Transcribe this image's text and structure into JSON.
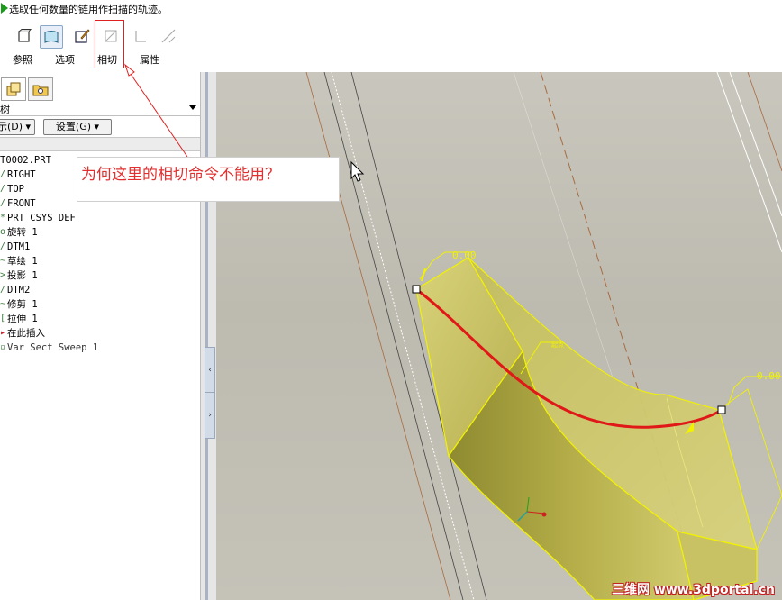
{
  "prompt": {
    "text": "选取任何数量的链用作扫描的轨迹。",
    "icon": "green-arrow-icon"
  },
  "dashboard": {
    "tools": [
      {
        "name": "solid-icon",
        "enabled": true,
        "active": false
      },
      {
        "name": "surface-icon",
        "enabled": true,
        "active": true
      },
      {
        "name": "sketch-edit-icon",
        "enabled": true,
        "active": false
      },
      {
        "name": "tangent-icon",
        "enabled": false,
        "active": false
      },
      {
        "name": "frame-icon",
        "enabled": false,
        "active": false
      },
      {
        "name": "normal-icon",
        "enabled": false,
        "active": false
      }
    ],
    "tabs": [
      "参照",
      "选项",
      "相切",
      "属性"
    ]
  },
  "tree": {
    "header_label": "树",
    "show_button": "示(D)",
    "settings_button": "设置(G)",
    "items": [
      {
        "label": "T0002.PRT",
        "icon": "part-icon"
      },
      {
        "label": "RIGHT",
        "icon": "datum-plane-icon"
      },
      {
        "label": "TOP",
        "icon": "datum-plane-icon"
      },
      {
        "label": "FRONT",
        "icon": "datum-plane-icon"
      },
      {
        "label": "PRT_CSYS_DEF",
        "icon": "csys-icon"
      },
      {
        "label": "旋转 1",
        "icon": "revolve-icon"
      },
      {
        "label": "DTM1",
        "icon": "datum-plane-icon"
      },
      {
        "label": "草绘 1",
        "icon": "sketch-icon"
      },
      {
        "label": "投影 1",
        "icon": "project-icon"
      },
      {
        "label": "DTM2",
        "icon": "datum-plane-icon"
      },
      {
        "label": "修剪 1",
        "icon": "trim-icon"
      },
      {
        "label": "拉伸 1",
        "icon": "extrude-icon"
      },
      {
        "label": "在此插入",
        "icon": "insert-arrow-icon"
      },
      {
        "label": "Var Sect Sweep 1",
        "icon": "var-sweep-icon"
      }
    ]
  },
  "viewport": {
    "dim_labels": [
      "0.00",
      "0.00"
    ],
    "start_label": "起点",
    "colors": {
      "surface": "#c8c060",
      "surface_dark": "#9c9630",
      "edge": "#f2f200",
      "trajectory": "#e01818",
      "background": "#c5c3b8"
    }
  },
  "annotation": {
    "question": "为何这里的相切命令不能用？",
    "color": "#e23030"
  },
  "watermark": "三维网 www.3dportal.cn"
}
